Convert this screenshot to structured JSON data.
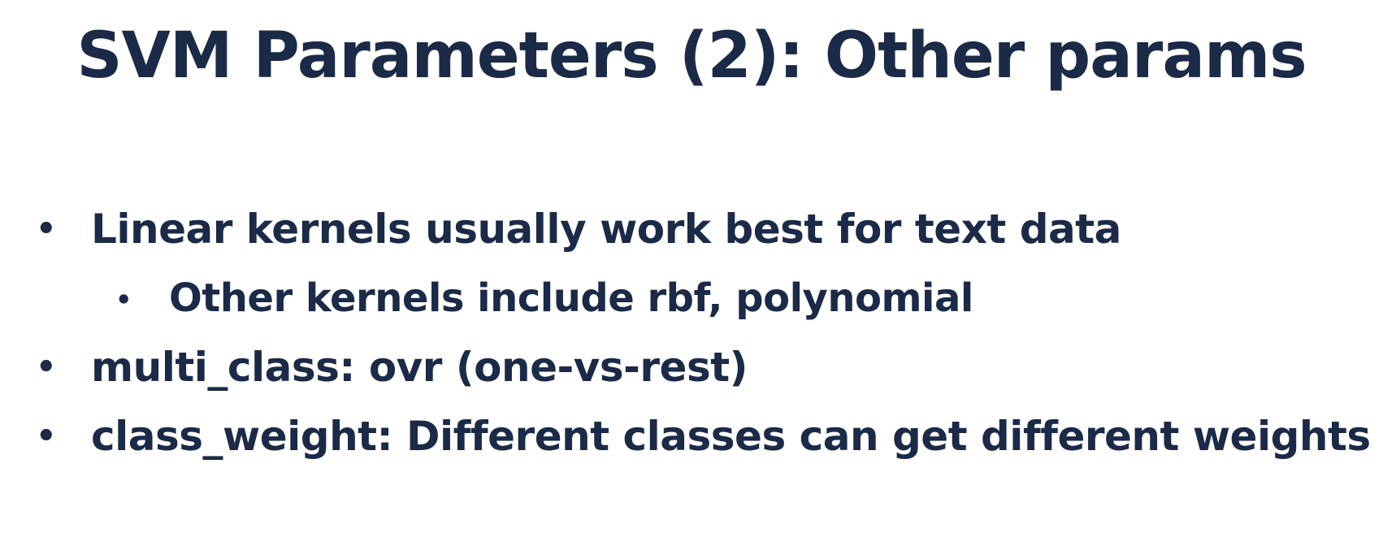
{
  "slide": {
    "title": "SVM Parameters (2): Other params",
    "bullet_glyph": "•",
    "bullets": [
      {
        "level": 1,
        "text": "Linear kernels usually work best for text data"
      },
      {
        "level": 2,
        "text": "Other kernels include rbf, polynomial"
      },
      {
        "level": 1,
        "text": "multi_class: ovr (one-vs-rest)"
      },
      {
        "level": 1,
        "text": "class_weight: Different classes can get different weights"
      }
    ]
  },
  "colors": {
    "text": "#1a2a47",
    "background": "#ffffff"
  }
}
